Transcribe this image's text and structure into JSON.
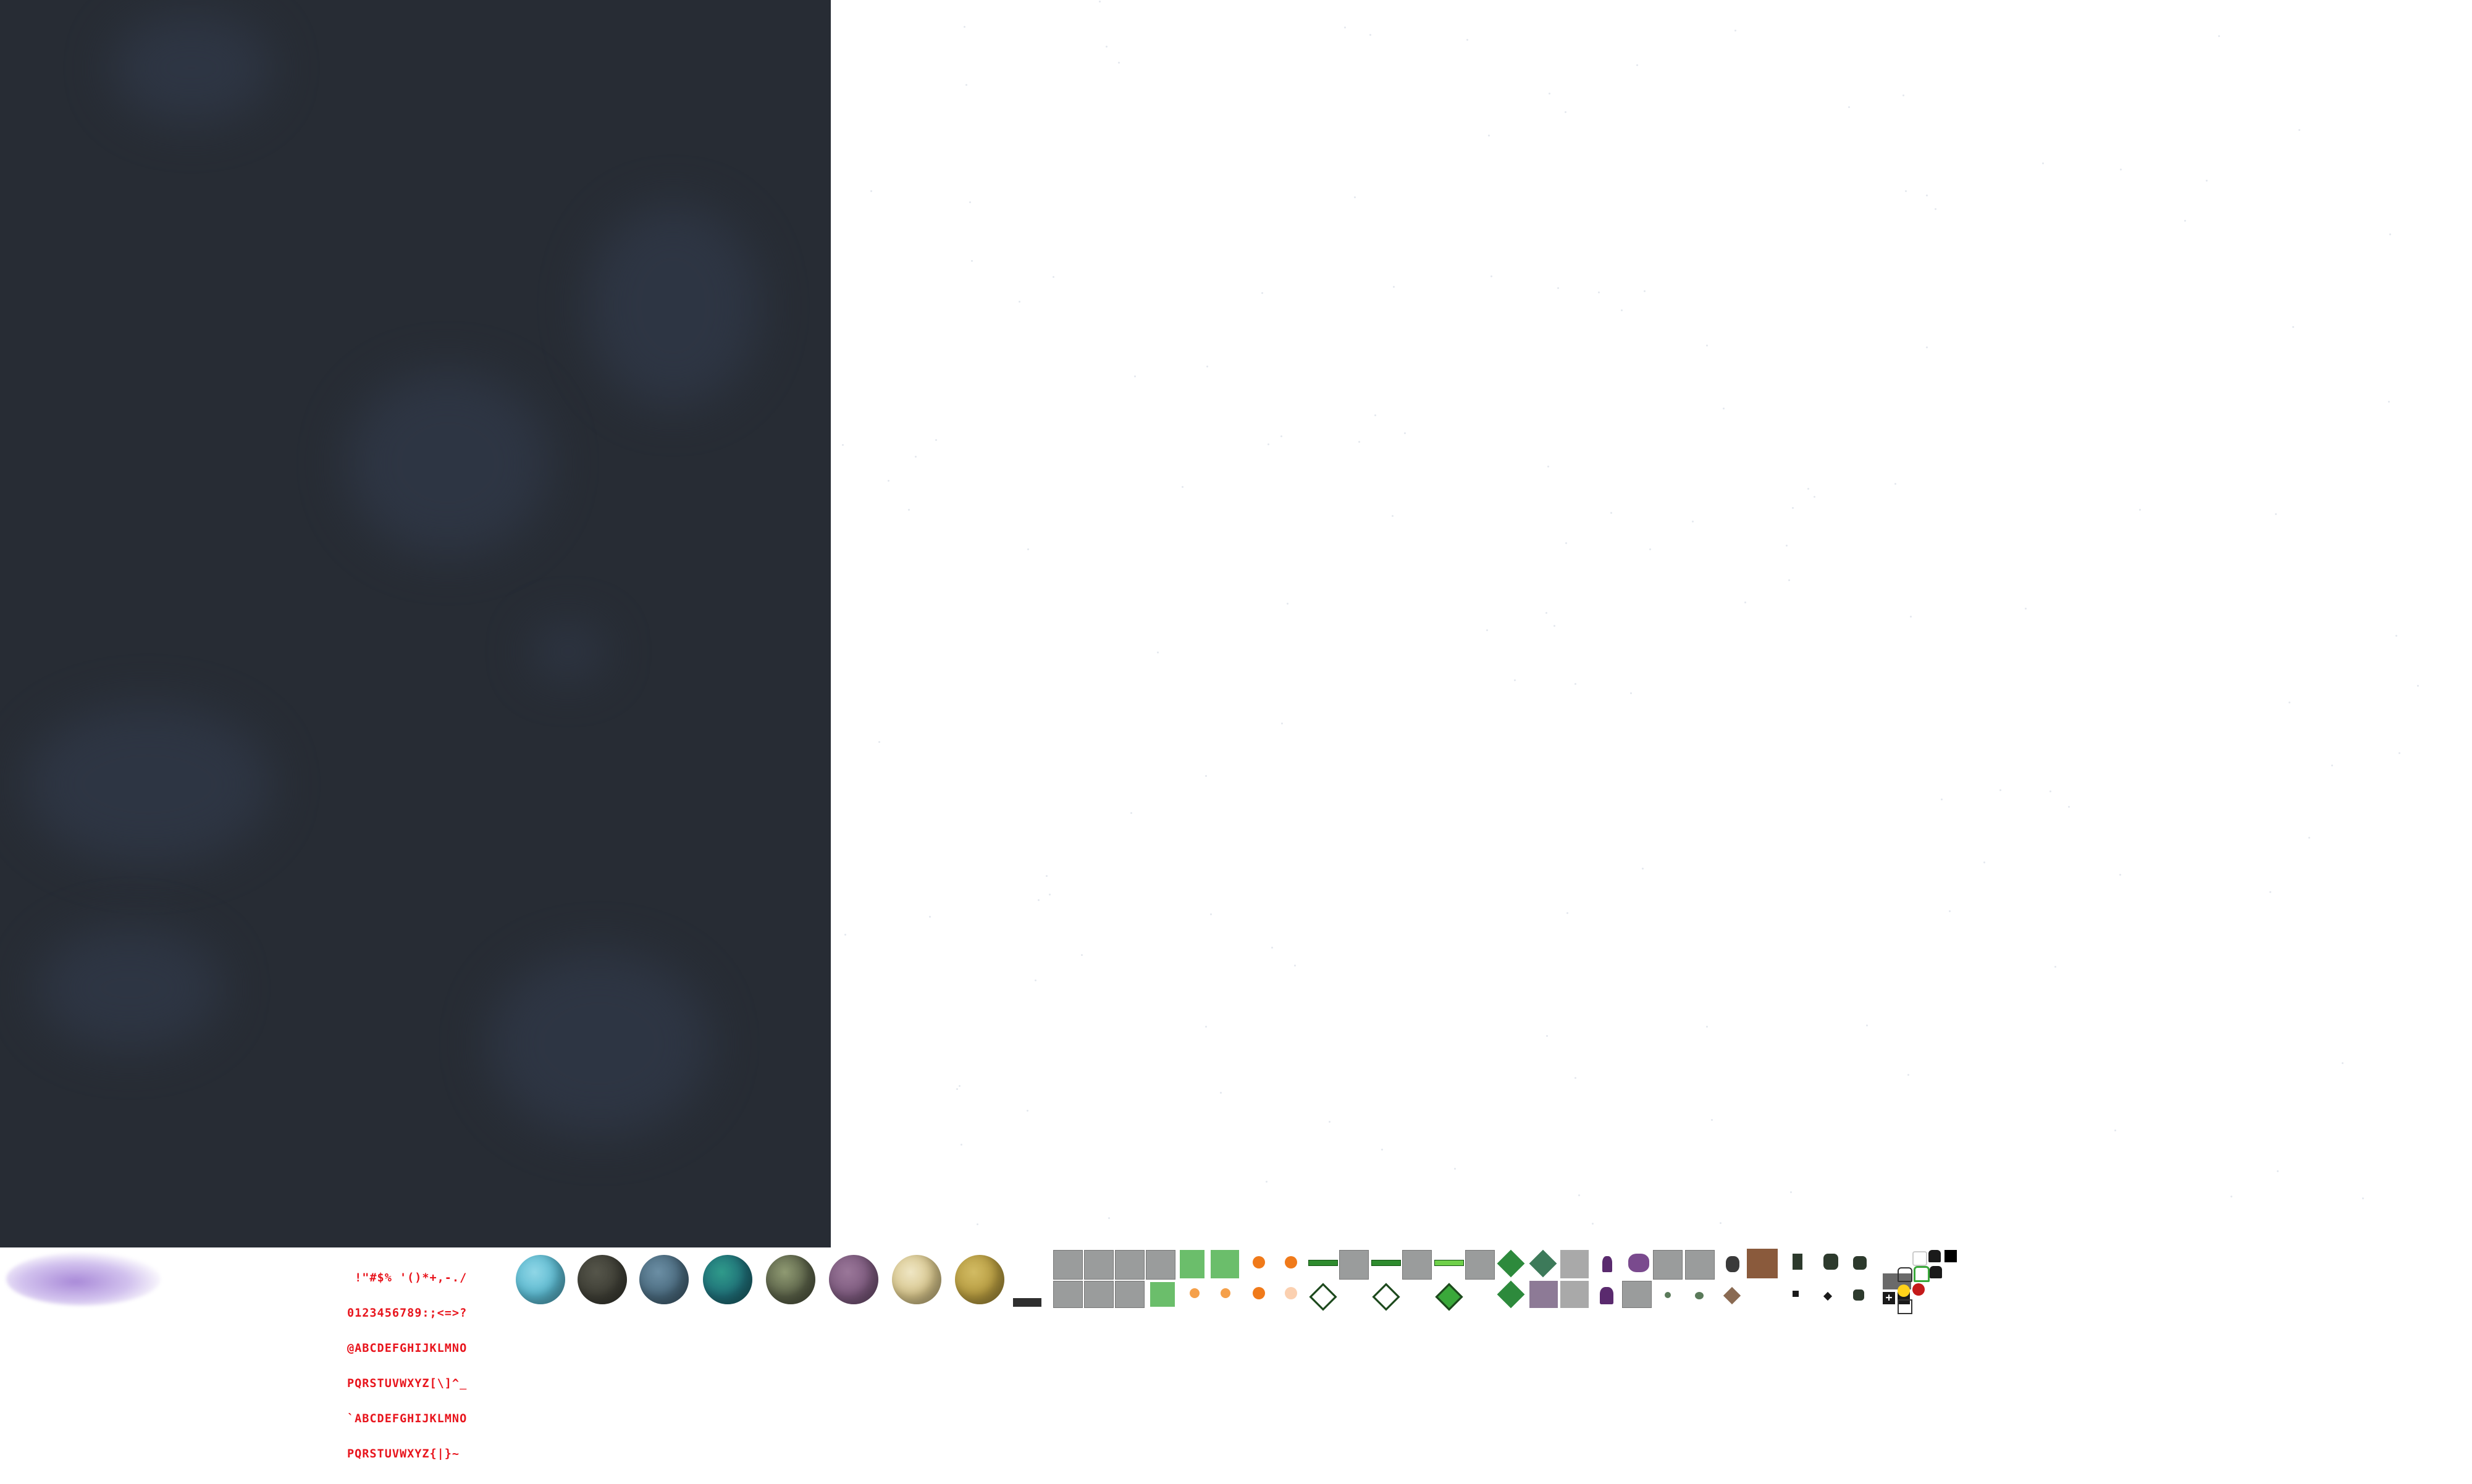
{
  "atlas": {
    "backgrounds": {
      "space_nebula": {
        "color": "#272c34",
        "cloud_color": "#2f3746"
      },
      "starfield": {
        "color": "#ffffff",
        "star_color": "#e4e8ee"
      }
    },
    "bitmap_font": {
      "color": "#e8141c",
      "rows": [
        " !\"#$% '()*+,-./",
        "0123456789:;<=>?",
        "@ABCDEFGHIJKLMNO",
        "PQRSTUVWXYZ[\\]^_",
        "`ABCDEFGHIJKLMNO",
        "PQRSTUVWXYZ{|}~"
      ]
    },
    "planets": [
      {
        "name": "ocean-planet",
        "color": "#5ab8cf",
        "accent": "#8fd6e6"
      },
      {
        "name": "dark-rock-planet",
        "color": "#3f3f36",
        "accent": "#55554a"
      },
      {
        "name": "storm-planet",
        "color": "#4a6a7e",
        "accent": "#6b8ea4"
      },
      {
        "name": "teal-planet",
        "color": "#1f6f78",
        "accent": "#2f9a8a"
      },
      {
        "name": "swamp-planet",
        "color": "#5a6148",
        "accent": "#8f9a72"
      },
      {
        "name": "purple-planet",
        "color": "#7d5a7e",
        "accent": "#9a7799"
      },
      {
        "name": "cream-planet",
        "color": "#d6c48a",
        "accent": "#efe6c4"
      },
      {
        "name": "golden-planet",
        "color": "#b59a3f",
        "accent": "#d2bb63"
      }
    ],
    "colors": {
      "tile_gray": "#9a9c9c",
      "tile_green": "#3aa83a",
      "explosion_orange": "#f07a1a",
      "enemy_purple": "#5a2a6e",
      "brown_block": "#8a5a3c",
      "dark_ship": "#2d3a2d",
      "red_dot": "#c41a1a"
    }
  }
}
